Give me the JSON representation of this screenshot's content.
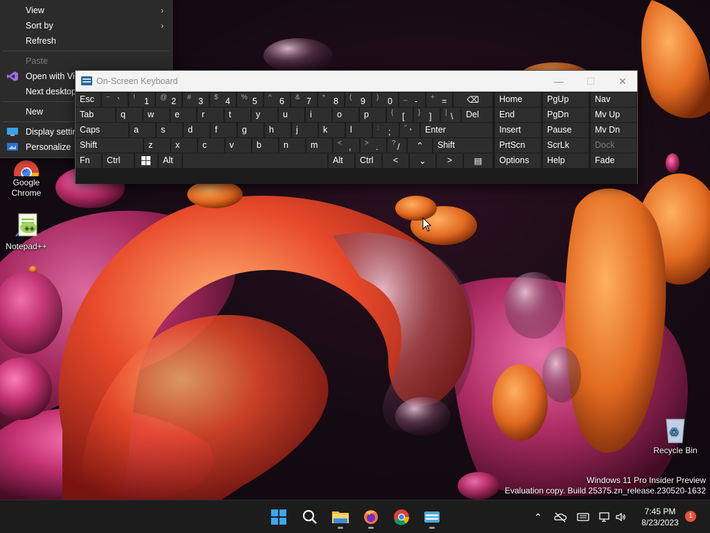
{
  "context_menu": {
    "items": [
      {
        "label": "View",
        "submenu": true
      },
      {
        "label": "Sort by",
        "submenu": true
      },
      {
        "label": "Refresh"
      },
      {
        "label": "Paste",
        "disabled": true
      },
      {
        "label": "Open with Vis",
        "icon": "visual-studio-icon"
      },
      {
        "label": "Next desktop"
      },
      {
        "label": "New",
        "submenu": true
      },
      {
        "label": "Display settin",
        "icon": "display-icon"
      },
      {
        "label": "Personalize",
        "icon": "personalize-icon"
      }
    ]
  },
  "desktop_icons": [
    {
      "label": "Google Chrome",
      "line1": "Google",
      "line2": "Chrome",
      "icon": "chrome-icon"
    },
    {
      "label": "Notepad++",
      "icon": "notepadpp-icon"
    },
    {
      "label": "Recycle Bin",
      "icon": "recycle-bin-icon"
    }
  ],
  "osk": {
    "title": "On-Screen Keyboard",
    "window_buttons": {
      "minimize": "—",
      "maximize": "☐",
      "close": "✕"
    },
    "row1": [
      {
        "label": "Esc"
      },
      {
        "sub": "~",
        "main": "`"
      },
      {
        "sub": "!",
        "main": "1"
      },
      {
        "sub": "@",
        "main": "2"
      },
      {
        "sub": "#",
        "main": "3"
      },
      {
        "sub": "$",
        "main": "4"
      },
      {
        "sub": "%",
        "main": "5"
      },
      {
        "sub": "^",
        "main": "6"
      },
      {
        "sub": "&",
        "main": "7"
      },
      {
        "sub": "*",
        "main": "8"
      },
      {
        "sub": "(",
        "main": "9"
      },
      {
        "sub": ")",
        "main": "0"
      },
      {
        "sub": "_",
        "main": "-"
      },
      {
        "sub": "+",
        "main": "="
      },
      {
        "label": "⌫"
      }
    ],
    "row2": [
      {
        "label": "Tab"
      },
      {
        "label": "q"
      },
      {
        "label": "w"
      },
      {
        "label": "e"
      },
      {
        "label": "r"
      },
      {
        "label": "t"
      },
      {
        "label": "y"
      },
      {
        "label": "u"
      },
      {
        "label": "i"
      },
      {
        "label": "o"
      },
      {
        "label": "p"
      },
      {
        "sub": "{",
        "main": "["
      },
      {
        "sub": "}",
        "main": "]"
      },
      {
        "sub": "|",
        "main": "\\"
      },
      {
        "label": "Del"
      }
    ],
    "row3": [
      {
        "label": "Caps"
      },
      {
        "label": "a"
      },
      {
        "label": "s"
      },
      {
        "label": "d"
      },
      {
        "label": "f"
      },
      {
        "label": "g"
      },
      {
        "label": "h"
      },
      {
        "label": "j"
      },
      {
        "label": "k"
      },
      {
        "label": "l"
      },
      {
        "sub": ":",
        "main": ";"
      },
      {
        "sub": "\"",
        "main": "'"
      },
      {
        "label": "Enter"
      }
    ],
    "row4": [
      {
        "label": "Shift"
      },
      {
        "label": "z"
      },
      {
        "label": "x"
      },
      {
        "label": "c"
      },
      {
        "label": "v"
      },
      {
        "label": "b"
      },
      {
        "label": "n"
      },
      {
        "label": "m"
      },
      {
        "sub": "<",
        "main": ","
      },
      {
        "sub": ">",
        "main": "."
      },
      {
        "sub": "?",
        "main": "/"
      },
      {
        "label": "⌃"
      },
      {
        "label": "Shift"
      }
    ],
    "row5": [
      {
        "label": "Fn"
      },
      {
        "label": "Ctrl"
      },
      {
        "label": "",
        "icon": "windows-key-icon"
      },
      {
        "label": "Alt"
      },
      {
        "label": ""
      },
      {
        "label": "Alt"
      },
      {
        "label": "Ctrl"
      },
      {
        "label": "<"
      },
      {
        "label": "⌄"
      },
      {
        "label": ">"
      },
      {
        "label": "▤"
      }
    ],
    "nav_keys": [
      [
        "Home",
        "PgUp",
        "Nav"
      ],
      [
        "End",
        "PgDn",
        "Mv Up"
      ],
      [
        "Insert",
        "Pause",
        "Mv Dn"
      ],
      [
        "PrtScn",
        "ScrLk",
        "Dock"
      ],
      [
        "Options",
        "Help",
        "Fade"
      ]
    ]
  },
  "watermark": {
    "line1": "Windows 11 Pro Insider Preview",
    "line2": "Evaluation copy. Build 25375.zn_release.230520-1632"
  },
  "taskbar": {
    "apps": [
      "start-icon",
      "search-icon",
      "file-explorer-icon",
      "firefox-icon",
      "chrome-icon",
      "osk-icon"
    ],
    "clock_time": "7:45 PM",
    "clock_date": "8/23/2023",
    "notification_count": "1"
  },
  "colors": {
    "accent_orange": "#e8533a",
    "menu_bg": "#2b2b2b",
    "key_bg": "#2d2d2d"
  }
}
